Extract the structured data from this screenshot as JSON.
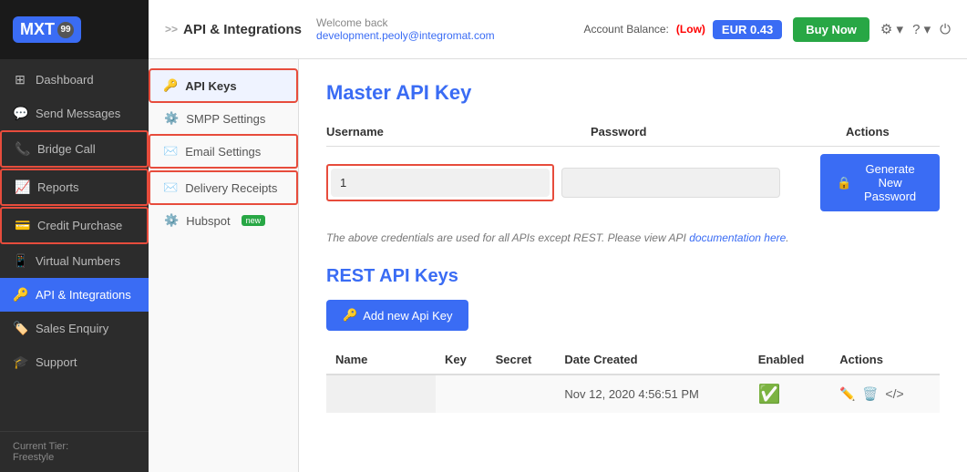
{
  "logo": {
    "text": "MXT",
    "badge": "99"
  },
  "sidebar": {
    "items": [
      {
        "id": "dashboard",
        "label": "Dashboard",
        "icon": "⊞"
      },
      {
        "id": "send-messages",
        "label": "Send Messages",
        "icon": "💬"
      },
      {
        "id": "bridge-call",
        "label": "Bridge Call",
        "icon": "📞"
      },
      {
        "id": "reports",
        "label": "Reports",
        "icon": "📈"
      },
      {
        "id": "credit-purchase",
        "label": "Credit Purchase",
        "icon": "💳"
      },
      {
        "id": "virtual-numbers",
        "label": "Virtual Numbers",
        "icon": "📱"
      },
      {
        "id": "api-integrations",
        "label": "API & Integrations",
        "icon": "🔑"
      },
      {
        "id": "sales-enquiry",
        "label": "Sales Enquiry",
        "icon": "🏷️"
      },
      {
        "id": "support",
        "label": "Support",
        "icon": "🎓"
      }
    ],
    "active": "api-integrations",
    "footer": {
      "tier_label": "Current Tier:",
      "tier_value": "Freestyle"
    }
  },
  "sub_sidebar": {
    "items": [
      {
        "id": "api-keys",
        "label": "API Keys",
        "icon": "🔑",
        "active": true
      },
      {
        "id": "smpp-settings",
        "label": "SMPP Settings",
        "icon": "⚙️"
      },
      {
        "id": "email-settings",
        "label": "Email Settings",
        "icon": "✉️"
      },
      {
        "id": "delivery-receipts",
        "label": "Delivery Receipts",
        "icon": "✉️"
      },
      {
        "id": "hubspot",
        "label": "Hubspot",
        "icon": "⚙️",
        "new": true
      }
    ]
  },
  "header": {
    "breadcrumb_arrow": ">>",
    "breadcrumb_title": "API & Integrations",
    "welcome_text": "Welcome back",
    "email": "development.peoly@integromat.com",
    "account_balance_label": "Account Balance:",
    "account_balance_status": "(Low)",
    "currency": "EUR",
    "balance": "0.43",
    "buy_now_label": "Buy Now",
    "icons": [
      "⚙",
      "?",
      "⏻"
    ]
  },
  "master_api": {
    "title": "Master API Key",
    "col_username": "Username",
    "col_password": "Password",
    "col_actions": "Actions",
    "username_value": "1",
    "password_value": "",
    "generate_btn": "Generate New Password",
    "note": "The above credentials are used for all APIs except REST. Please view API",
    "note_link": "documentation here",
    "note_end": "."
  },
  "rest_api": {
    "title": "REST API Keys",
    "add_btn": "Add new Api Key",
    "columns": [
      "Name",
      "Key",
      "Secret",
      "Date Created",
      "Enabled",
      "Actions"
    ],
    "rows": [
      {
        "name": "",
        "key": "",
        "secret": "",
        "date_created": "Nov 12, 2020 4:56:51 PM",
        "enabled": true
      }
    ]
  }
}
